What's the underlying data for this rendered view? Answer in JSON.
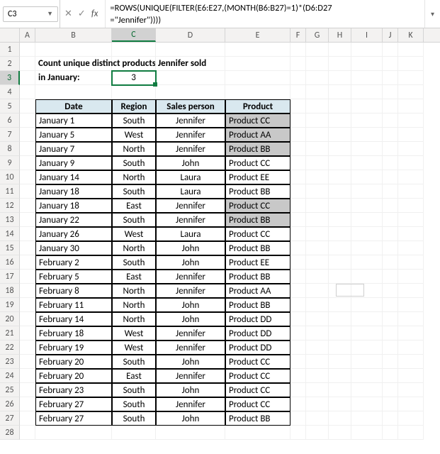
{
  "namebox": {
    "ref": "C3"
  },
  "fx": {
    "cancel": "✕",
    "accept": "✓",
    "label": "fx"
  },
  "formula": "=ROWS(UNIQUE(FILTER(E6:E27,(MONTH(B6:B27)=1)*(D6:D27\n=\"Jennifer\"))))",
  "columns": [
    "A",
    "B",
    "C",
    "D",
    "E",
    "F",
    "G",
    "H",
    "I",
    "J",
    "K"
  ],
  "title1": "Count unique distinct products  Jennifer sold",
  "title2": "in January:",
  "result": "3",
  "headers": {
    "date": "Date",
    "region": "Region",
    "person": "Sales person",
    "product": "Product"
  },
  "rows": [
    {
      "n": 6,
      "date": "January 1",
      "region": "South",
      "person": "Jennifer",
      "product": "Product CC",
      "hl": true
    },
    {
      "n": 7,
      "date": "January 5",
      "region": "West",
      "person": "Jennifer",
      "product": "Product AA",
      "hl": true
    },
    {
      "n": 8,
      "date": "January 7",
      "region": "North",
      "person": "Jennifer",
      "product": "Product BB",
      "hl": true
    },
    {
      "n": 9,
      "date": "January 9",
      "region": "South",
      "person": "John",
      "product": "Product CC",
      "hl": false
    },
    {
      "n": 10,
      "date": "January 14",
      "region": "North",
      "person": "Laura",
      "product": "Product EE",
      "hl": false
    },
    {
      "n": 11,
      "date": "January 18",
      "region": "South",
      "person": "Laura",
      "product": "Product BB",
      "hl": false
    },
    {
      "n": 12,
      "date": "January 18",
      "region": "East",
      "person": "Jennifer",
      "product": "Product CC",
      "hl": true
    },
    {
      "n": 13,
      "date": "January 22",
      "region": "South",
      "person": "Jennifer",
      "product": "Product BB",
      "hl": true
    },
    {
      "n": 14,
      "date": "January 26",
      "region": "West",
      "person": "Laura",
      "product": "Product CC",
      "hl": false
    },
    {
      "n": 15,
      "date": "January 30",
      "region": "North",
      "person": "John",
      "product": "Product BB",
      "hl": false
    },
    {
      "n": 16,
      "date": "February 2",
      "region": "South",
      "person": "John",
      "product": "Product EE",
      "hl": false
    },
    {
      "n": 17,
      "date": "February 5",
      "region": "East",
      "person": "Jennifer",
      "product": "Product BB",
      "hl": false
    },
    {
      "n": 18,
      "date": "February 8",
      "region": "North",
      "person": "Jennifer",
      "product": "Product AA",
      "hl": false
    },
    {
      "n": 19,
      "date": "February 11",
      "region": "North",
      "person": "John",
      "product": "Product BB",
      "hl": false
    },
    {
      "n": 20,
      "date": "February 14",
      "region": "North",
      "person": "John",
      "product": "Product DD",
      "hl": false
    },
    {
      "n": 21,
      "date": "February 18",
      "region": "West",
      "person": "Jennifer",
      "product": "Product DD",
      "hl": false
    },
    {
      "n": 22,
      "date": "February 19",
      "region": "West",
      "person": "Jennifer",
      "product": "Product DD",
      "hl": false
    },
    {
      "n": 23,
      "date": "February 20",
      "region": "South",
      "person": "John",
      "product": "Product CC",
      "hl": false
    },
    {
      "n": 24,
      "date": "February 20",
      "region": "East",
      "person": "Jennifer",
      "product": "Product CC",
      "hl": false
    },
    {
      "n": 25,
      "date": "February 23",
      "region": "South",
      "person": "John",
      "product": "Product CC",
      "hl": false
    },
    {
      "n": 26,
      "date": "February 27",
      "region": "South",
      "person": "Jennifer",
      "product": "Product CC",
      "hl": false
    },
    {
      "n": 27,
      "date": "February 27",
      "region": "South",
      "person": "John",
      "product": "Product BB",
      "hl": false
    }
  ],
  "trailingRows": [
    28
  ]
}
